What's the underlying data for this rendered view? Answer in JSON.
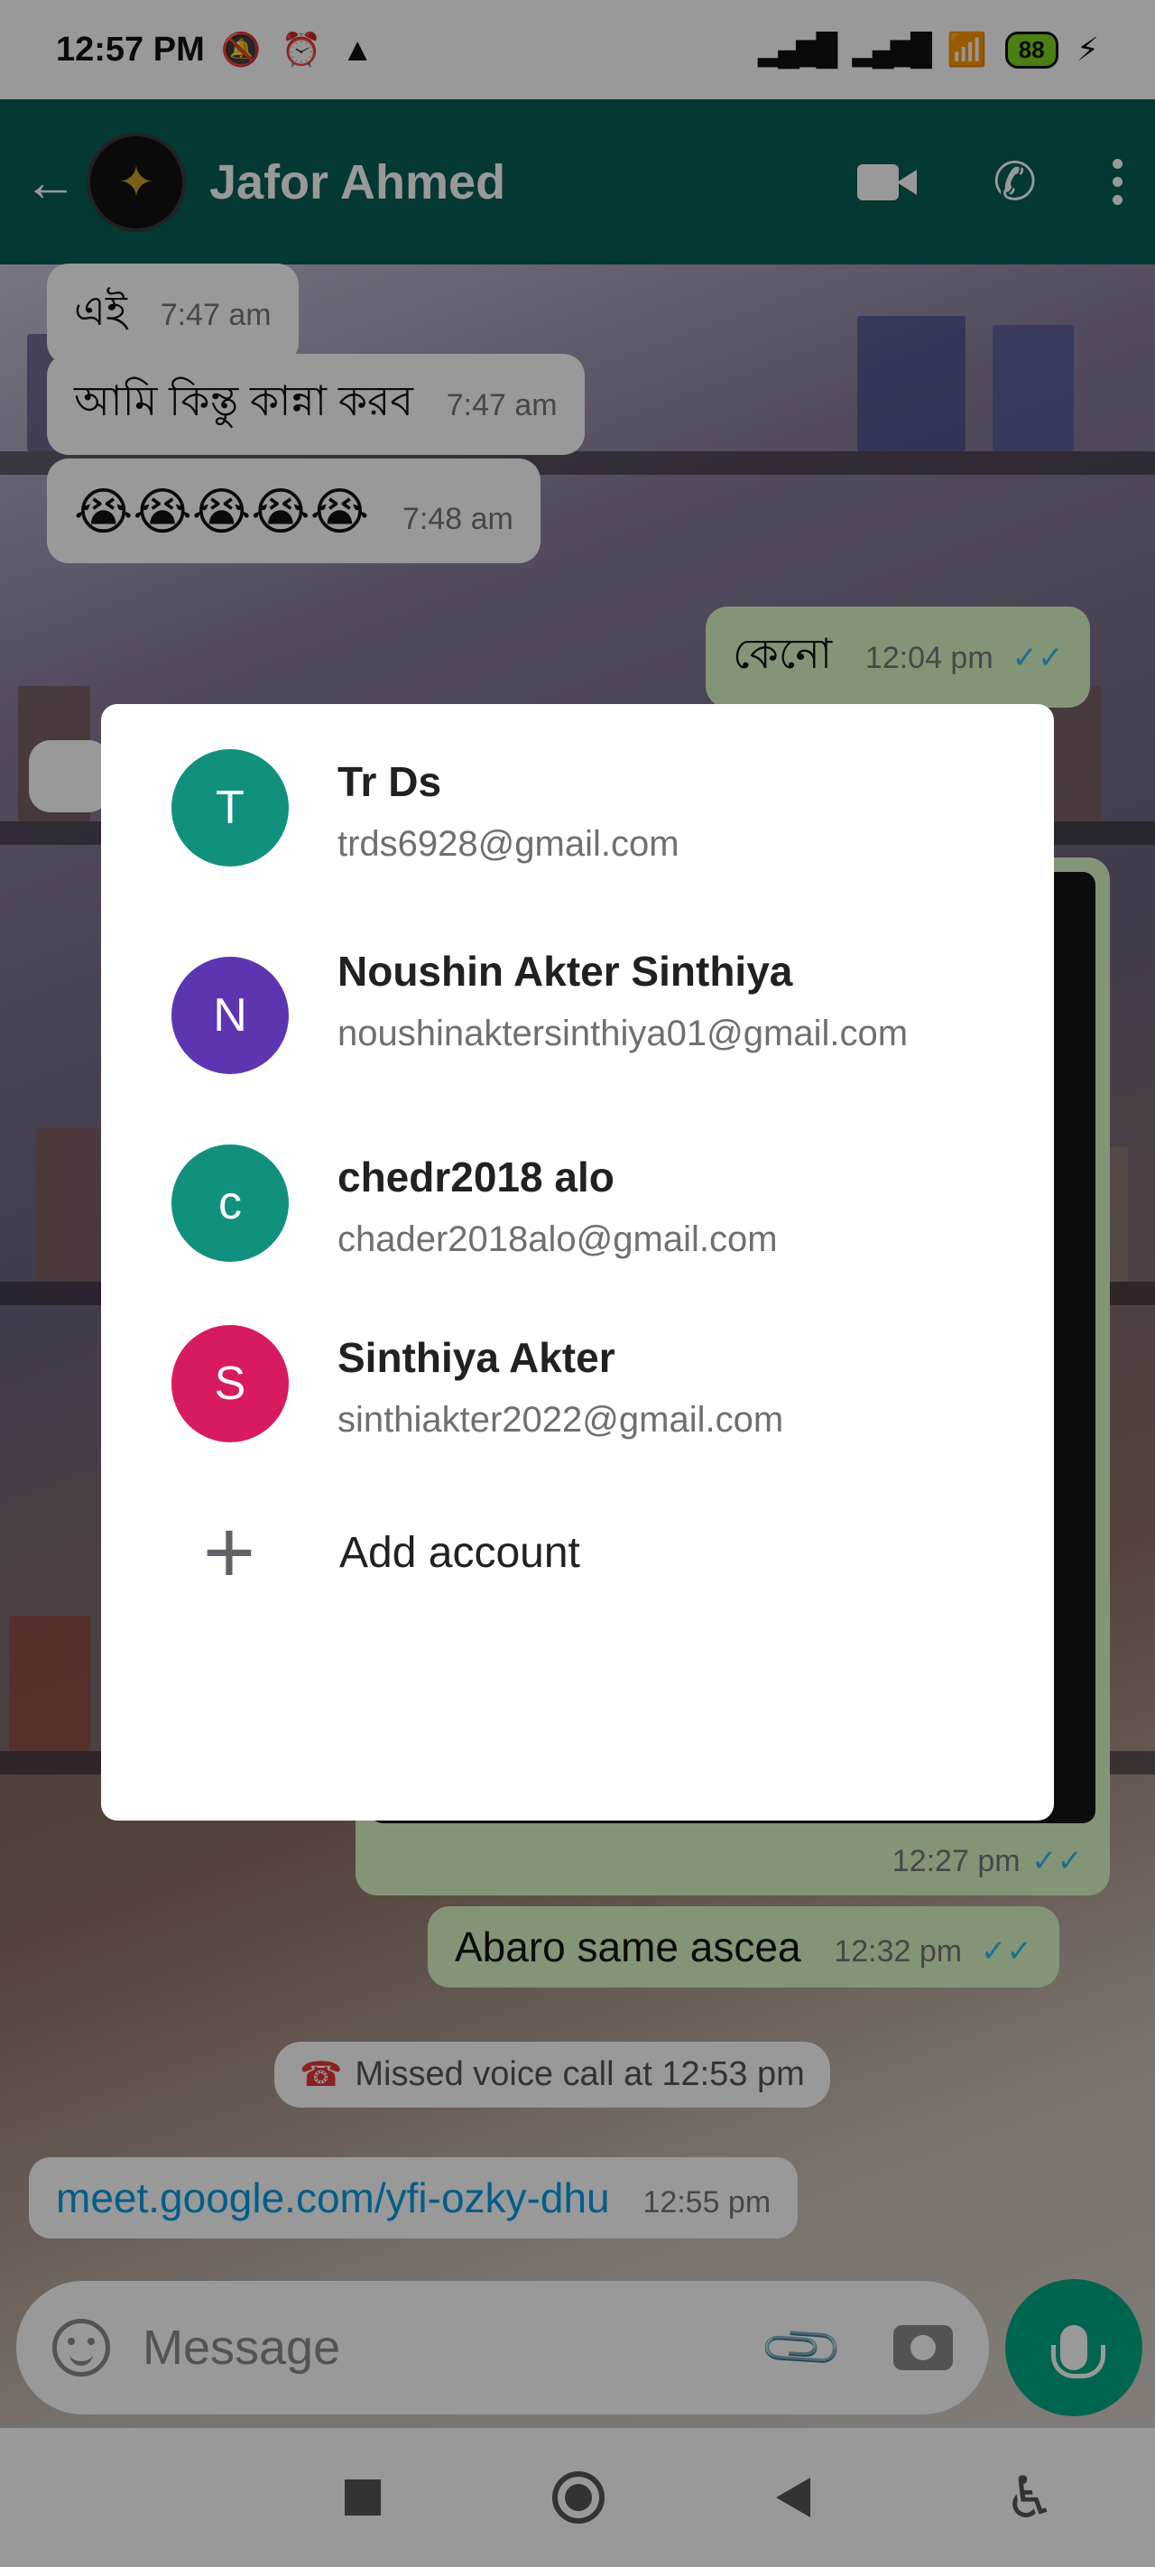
{
  "status_bar": {
    "time": "12:57 PM",
    "battery": "88"
  },
  "header": {
    "contact_name": "Jafor Ahmed",
    "icons": [
      "back-arrow-icon",
      "video-call-icon",
      "voice-call-icon",
      "more-options-icon"
    ]
  },
  "messages": [
    {
      "direction": "in",
      "text": "এই",
      "time": "7:47 am"
    },
    {
      "direction": "in",
      "text": "আমি কিন্তু কান্না করব",
      "time": "7:47 am"
    },
    {
      "direction": "in",
      "text": "😭😭😭😭😭",
      "time": "7:48 am"
    },
    {
      "direction": "out",
      "text": "কেনো",
      "time": "12:04 pm"
    },
    {
      "direction": "out",
      "media": true,
      "time": "12:27 pm"
    },
    {
      "direction": "out",
      "text": "Abaro same ascea",
      "time": "12:32 pm"
    }
  ],
  "missed_call": "Missed voice call at 12:53 pm",
  "link_message": {
    "text": "meet.google.com/yfi-ozky-dhu",
    "time": "12:55 pm"
  },
  "compose": {
    "placeholder": "Message"
  },
  "account_dialog": {
    "accounts": [
      {
        "initial": "T",
        "name": "Tr Ds",
        "email": "trds6928@gmail.com",
        "color": "#12907e"
      },
      {
        "initial": "N",
        "name": "Noushin Akter Sinthiya",
        "email": "noushinaktersinthiya01@gmail.com",
        "color": "#5e35b1"
      },
      {
        "initial": "c",
        "name": "chedr2018 alo",
        "email": "chader2018alo@gmail.com",
        "color": "#12907e"
      },
      {
        "initial": "S",
        "name": "Sinthiya Akter",
        "email": "sinthiakter2022@gmail.com",
        "color": "#d81b60"
      }
    ],
    "add_account_label": "Add account"
  },
  "colors": {
    "header": "#075e54",
    "outgoing_bubble": "#dcf8c6",
    "mic_button": "#00a884"
  }
}
